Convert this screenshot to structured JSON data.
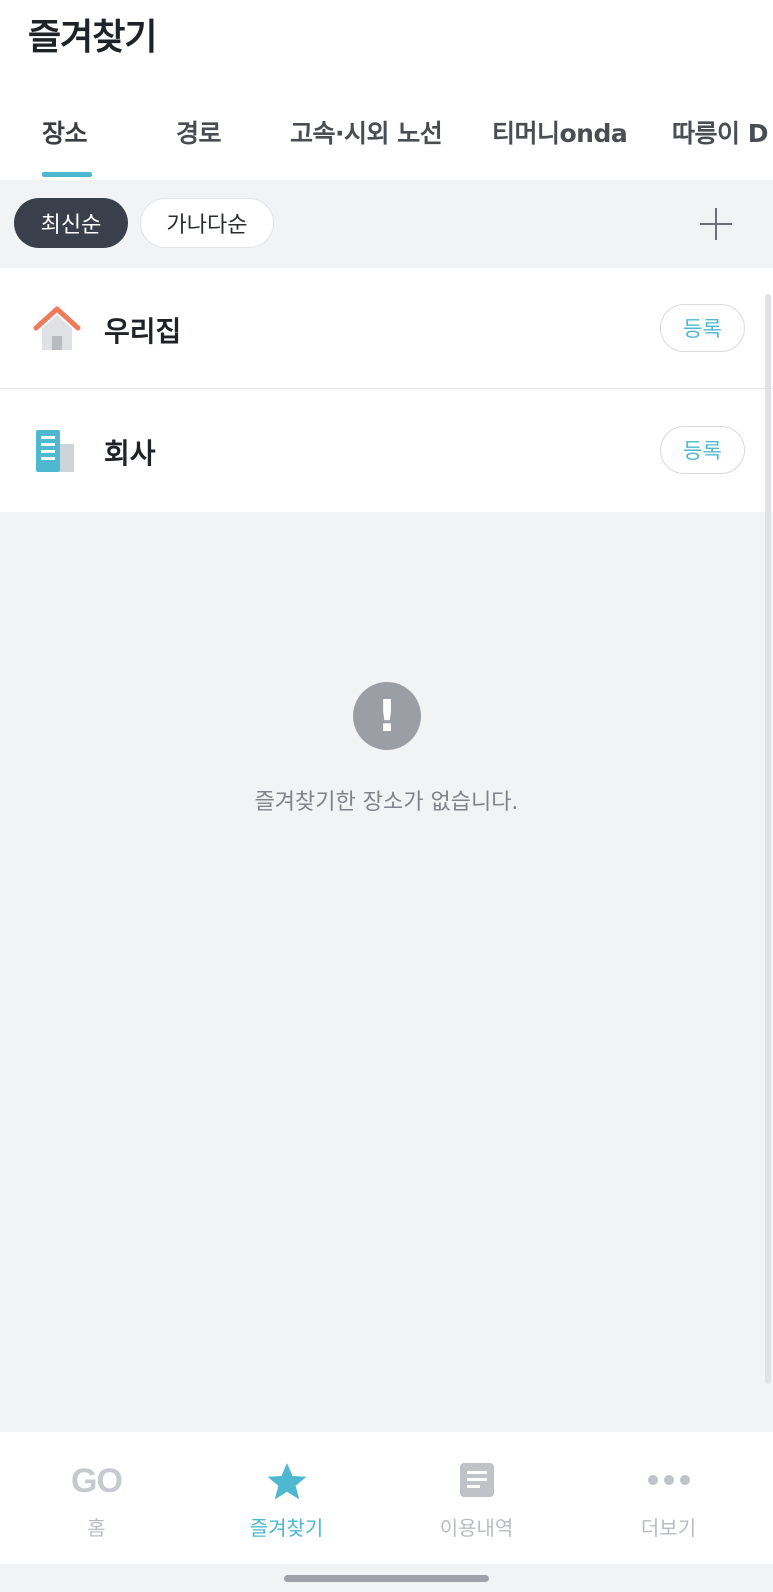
{
  "header": {
    "title": "즐겨찾기"
  },
  "tabs": [
    {
      "label": "장소",
      "active": true
    },
    {
      "label": "경로",
      "active": false
    },
    {
      "label": "고속·시외 노선",
      "active": false
    },
    {
      "label": "티머니onda",
      "active": false
    },
    {
      "label": "따릉이 D",
      "active": false
    }
  ],
  "filters": {
    "chips": [
      {
        "label": "최신순",
        "active": true
      },
      {
        "label": "가나다순",
        "active": false
      }
    ],
    "add_icon": "plus-icon"
  },
  "places": [
    {
      "label": "우리집",
      "icon": "home-icon",
      "button": "등록"
    },
    {
      "label": "회사",
      "icon": "office-building-icon",
      "button": "등록"
    }
  ],
  "empty": {
    "icon": "exclamation-icon",
    "message": "즐겨찾기한 장소가 없습니다."
  },
  "bottom_nav": [
    {
      "label": "홈",
      "icon": "go-logo-icon",
      "icon_text": "GO",
      "active": false
    },
    {
      "label": "즐겨찾기",
      "icon": "star-icon",
      "active": true
    },
    {
      "label": "이용내역",
      "icon": "document-icon",
      "active": false
    },
    {
      "label": "더보기",
      "icon": "more-dots-icon",
      "active": false
    }
  ],
  "colors": {
    "accent": "#4db8cf",
    "chip_active_bg": "#3a404b",
    "background_gray": "#f2f3f5",
    "home_icon_roof": "#ee7b5a"
  }
}
